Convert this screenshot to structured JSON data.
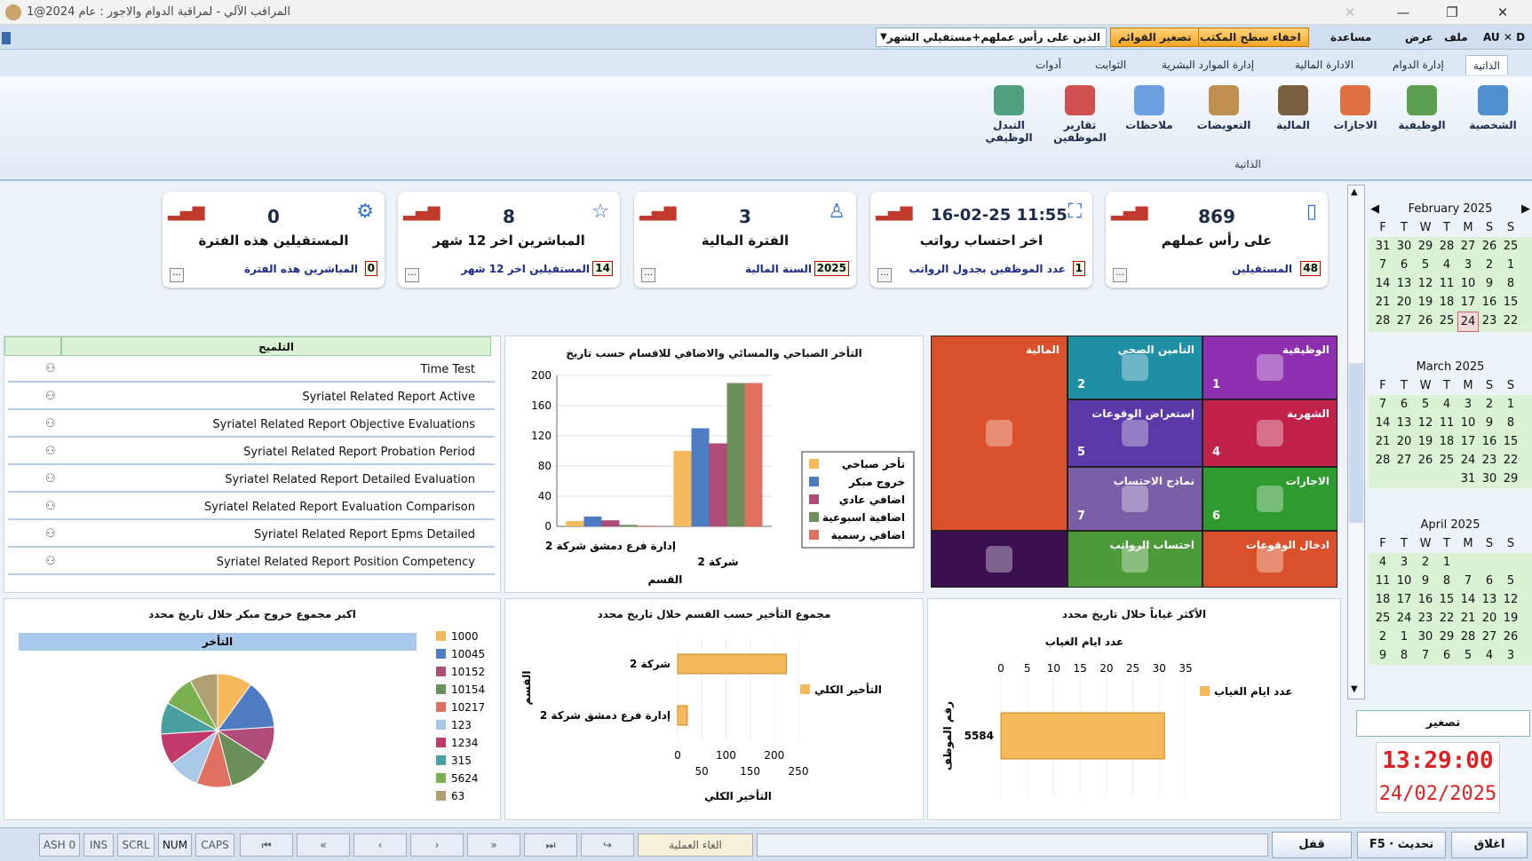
{
  "window": {
    "title": "المراقب الآلي - لمراقبة الدوام والاجور  :  عام 2024@1",
    "close": "✕",
    "maximize": "❐",
    "minimize": "—"
  },
  "menu": {
    "file": "ملف",
    "view": "عرض",
    "help": "مساعدة",
    "hide_desktop": "اخفاء سطح المكتب",
    "shrink_lists": "تصغير القوائم",
    "filter": "الذين على رأس عملهم+مستقيلي الشهر",
    "lang": "AU ✕ D"
  },
  "tabs": [
    "الذاتية",
    "إدارة الدوام",
    "الادارة المالية",
    "إدارة الموارد البشرية",
    "الثوابت",
    "أدوات"
  ],
  "ribbon": {
    "buttons": [
      "الشخصية",
      "الوظيفية",
      "الاجازات",
      "المالية",
      "التعويضات",
      "ملاحظات",
      "تقارير الموظفين",
      "التبدل الوظيفي"
    ],
    "group": "الذاتية"
  },
  "cards": [
    {
      "value": "869",
      "label": "على رأس عملهم",
      "sub": "المستقيلين",
      "subv": "48"
    },
    {
      "value": "16-02-25 11:55",
      "label": "اخر احتساب رواتب",
      "sub": "عدد الموظفين بجدول الرواتب",
      "subv": "1"
    },
    {
      "value": "3",
      "label": "الفترة المالية",
      "sub": "السنة المالية",
      "subv": "2025"
    },
    {
      "value": "8",
      "label": "المباشرين اخر 12 شهر",
      "sub": "المستقيلين اخر 12 شهر",
      "subv": "14"
    },
    {
      "value": "0",
      "label": "المستقيلين هذه الفترة",
      "sub": "المباشرين هذه الفترة",
      "subv": "0"
    }
  ],
  "list": {
    "header": "التلميح",
    "items": [
      "Time Test",
      "Syriatel Related Report Active",
      "Syriatel Related Report Objective Evaluations",
      "Syriatel Related Report Probation Period",
      "Syriatel Related Report Detailed Evaluation",
      "Syriatel Related Report Evaluation Comparison",
      "Syriatel Related Report Epms Detailed",
      "Syriatel Related Report Position Competency"
    ]
  },
  "tiles": [
    {
      "label": "الوظيفية",
      "num": "1",
      "color": "#8e2fb0"
    },
    {
      "label": "التأمين الصحي",
      "num": "2",
      "color": "#1f8fa6"
    },
    {
      "label": "الشهرية",
      "num": "4",
      "color": "#c0224a"
    },
    {
      "label": "إستعراض الوقوعات",
      "num": "5",
      "color": "#5a3aa8"
    },
    {
      "label": "الاجازات",
      "num": "6",
      "color": "#2f9a2f"
    },
    {
      "label": "نماذج الاحتساب",
      "num": "7",
      "color": "#7a5fa8"
    },
    {
      "label": "ادخال الوقوعات",
      "num": "",
      "color": "#d9502a"
    },
    {
      "label": "احتساب الرواتب",
      "num": "",
      "color": "#4c9a3a"
    },
    {
      "label": "المالية",
      "num": "",
      "color": "#d9502a"
    },
    {
      "label": "",
      "num": "",
      "color": "#3a1050"
    }
  ],
  "calendar": {
    "months": [
      "February 2025",
      "March 2025",
      "April 2025"
    ],
    "days": [
      "F",
      "T",
      "W",
      "T",
      "M",
      "S",
      "S"
    ],
    "feb": [
      [
        "31",
        "30",
        "29",
        "28",
        "27",
        "26",
        "25"
      ],
      [
        "7",
        "6",
        "5",
        "4",
        "3",
        "2",
        "1"
      ],
      [
        "14",
        "13",
        "12",
        "11",
        "10",
        "9",
        "8"
      ],
      [
        "21",
        "20",
        "19",
        "18",
        "17",
        "16",
        "15"
      ],
      [
        "28",
        "27",
        "26",
        "25",
        "24",
        "23",
        "22"
      ]
    ],
    "mar": [
      [
        "7",
        "6",
        "5",
        "4",
        "3",
        "2",
        "1"
      ],
      [
        "14",
        "13",
        "12",
        "11",
        "10",
        "9",
        "8"
      ],
      [
        "21",
        "20",
        "19",
        "18",
        "17",
        "16",
        "15"
      ],
      [
        "28",
        "27",
        "26",
        "25",
        "24",
        "23",
        "22"
      ],
      [
        "",
        "",
        "",
        "",
        "31",
        "30",
        "29"
      ]
    ],
    "apr": [
      [
        "4",
        "3",
        "2",
        "1",
        "",
        "",
        ""
      ],
      [
        "11",
        "10",
        "9",
        "8",
        "7",
        "6",
        "5"
      ],
      [
        "18",
        "17",
        "16",
        "15",
        "14",
        "13",
        "12"
      ],
      [
        "25",
        "24",
        "23",
        "22",
        "21",
        "20",
        "19"
      ],
      [
        "2",
        "1",
        "30",
        "29",
        "28",
        "27",
        "26"
      ],
      [
        "9",
        "8",
        "7",
        "6",
        "5",
        "4",
        "3"
      ]
    ],
    "shrink": "تصغير",
    "clock": "13:29:00",
    "date": "24/02/2025"
  },
  "status": {
    "keys": [
      "ASH 0",
      "INS",
      "SCRL",
      "NUM",
      "CAPS"
    ],
    "cancel": "الغاء العملية",
    "lock": "قفل",
    "refresh": "F5 · تحديث",
    "close": "اغلاق"
  },
  "chart_data": [
    {
      "type": "bar",
      "title": "التأخر الصباحي والمسائي والاضافي للاقسام حسب تاريخ",
      "xlabel": "القسم",
      "categories": [
        "إدارة فرع دمشق شركة 2",
        "شركة 2"
      ],
      "ylim": [
        0,
        200
      ],
      "series": [
        {
          "name": "تأخر صباحي",
          "values": [
            7,
            100
          ],
          "color": "#f5b95a"
        },
        {
          "name": "خروج مبكر",
          "values": [
            13,
            130
          ],
          "color": "#4d7cc2"
        },
        {
          "name": "اضافي عادي",
          "values": [
            8,
            110
          ],
          "color": "#b04c7a"
        },
        {
          "name": "اضافية اسبوعية",
          "values": [
            2,
            190
          ],
          "color": "#6a8f5a"
        },
        {
          "name": "اضافي رسمية",
          "values": [
            1,
            190
          ],
          "color": "#e07060"
        }
      ]
    },
    {
      "type": "pie",
      "title": "اكبر مجموع  خروج مبكر خلال تاريخ محدد",
      "header": "التأخر",
      "labels": [
        "1000",
        "10045",
        "10152",
        "10154",
        "10217",
        "123",
        "1234",
        "315",
        "5624",
        "63"
      ],
      "values": [
        10,
        14,
        10,
        12,
        10,
        9,
        9,
        9,
        9,
        8
      ],
      "colors": [
        "#f5b95a",
        "#4d7cc2",
        "#b04c7a",
        "#6a8f5a",
        "#e07060",
        "#a8c8e8",
        "#c23a6a",
        "#4aa0a0",
        "#7bb050",
        "#b0a070"
      ]
    },
    {
      "type": "bar",
      "title": "مجموع التأخير حسب القسم خلال تاريخ محدد",
      "xlabel": "التأخير الكلي",
      "ylabel": "القسم",
      "categories": [
        "شركة 2",
        "إدارة فرع دمشق شركة 2"
      ],
      "series": [
        {
          "name": "التأخير الكلي",
          "values": [
            225,
            20
          ],
          "color": "#f5b95a"
        }
      ],
      "xlim": [
        0,
        250
      ]
    },
    {
      "type": "bar",
      "title": "الأكثر غياباً خلال تاريخ محدد",
      "xlabel": "عدد ايام الغياب",
      "ylabel": "رقم الموظف",
      "categories": [
        "5584"
      ],
      "series": [
        {
          "name": "عدد ايام الغياب",
          "values": [
            31
          ],
          "color": "#f5b95a"
        }
      ],
      "xlim": [
        0,
        35
      ]
    }
  ]
}
